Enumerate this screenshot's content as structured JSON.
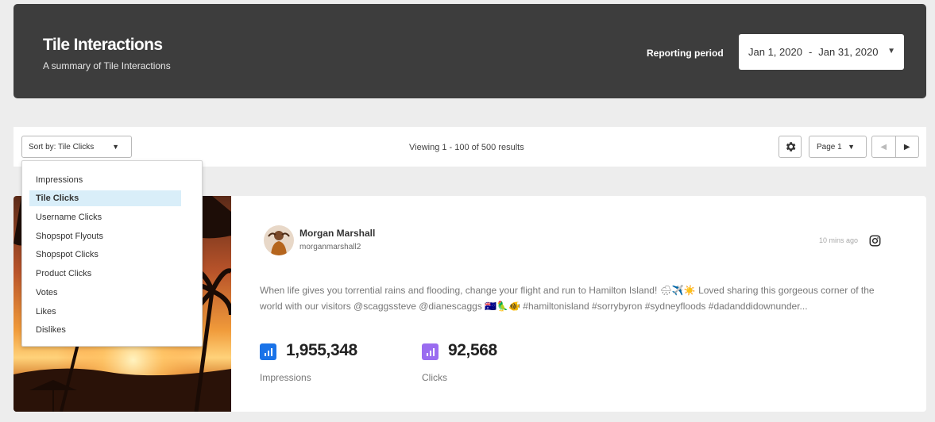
{
  "header": {
    "title": "Tile Interactions",
    "subtitle": "A summary of Tile Interactions",
    "period_label": "Reporting period",
    "date_start": "Jan 1, 2020",
    "date_sep": "-",
    "date_end": "Jan 31, 2020"
  },
  "toolbar": {
    "sort_label": "Sort by: Tile Clicks",
    "viewing": "Viewing 1 - 100 of 500 results",
    "page_label": "Page 1"
  },
  "sort_menu": {
    "selected": "Tile Clicks",
    "items": [
      "Impressions",
      "Tile Clicks",
      "Username Clicks",
      "Shopspot Flyouts",
      "Shopspot Clicks",
      "Product Clicks",
      "Votes",
      "Likes",
      "Dislikes"
    ]
  },
  "post": {
    "user_name": "Morgan Marshall",
    "handle": "morganmarshall2",
    "time_ago": "10 mins ago",
    "caption": "When life gives you torrential rains and flooding, change your flight and run to Hamilton Island! 🌧✈️☀️ Loved sharing this gorgeous corner of the world with our visitors @scaggssteve @dianescaggs 🇦🇺🦜🐠 #hamiltonisland #sorrybyron #sydneyfloods #dadanddidownunder...",
    "impressions_value": "1,955,348",
    "impressions_label": "Impressions",
    "clicks_value": "92,568",
    "clicks_label": "Clicks"
  },
  "colors": {
    "header_bg": "#3d3d3d",
    "impressions_icon": "#1a73e8",
    "clicks_icon": "#9a6cf0",
    "selected_item_bg": "#d9eef9"
  },
  "icons": {
    "settings": "gear-icon",
    "prev": "chevron-left-icon",
    "next": "chevron-right-icon",
    "platform": "instagram-icon",
    "stat": "bar-chart-icon"
  }
}
